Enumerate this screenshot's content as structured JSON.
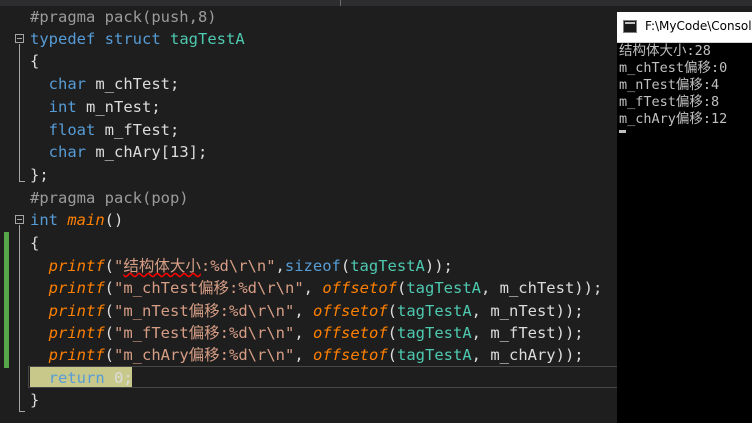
{
  "editor": {
    "lines": [
      [
        [
          "pp",
          "#pragma pack(push,8)"
        ]
      ],
      [
        [
          "kw",
          "typedef"
        ],
        [
          "id",
          " "
        ],
        [
          "kw",
          "struct"
        ],
        [
          "id",
          " "
        ],
        [
          "ty",
          "tagTestA"
        ]
      ],
      [
        [
          "id",
          "{"
        ]
      ],
      [
        [
          "id",
          "  "
        ],
        [
          "kw",
          "char"
        ],
        [
          "id",
          " m_chTest;"
        ]
      ],
      [
        [
          "id",
          "  "
        ],
        [
          "kw",
          "int"
        ],
        [
          "id",
          " m_nTest;"
        ]
      ],
      [
        [
          "id",
          "  "
        ],
        [
          "kw",
          "float"
        ],
        [
          "id",
          " m_fTest;"
        ]
      ],
      [
        [
          "id",
          "  "
        ],
        [
          "kw",
          "char"
        ],
        [
          "id",
          " m_chAry[13];"
        ]
      ],
      [
        [
          "id",
          "};"
        ]
      ],
      [
        [
          "pp",
          "#pragma pack(pop)"
        ]
      ],
      [
        [
          "kw",
          "int"
        ],
        [
          "id",
          " "
        ],
        [
          "fn",
          "main"
        ],
        [
          "id",
          "()"
        ]
      ],
      [
        [
          "id",
          "{"
        ]
      ],
      [
        [
          "id",
          "  "
        ],
        [
          "fn",
          "printf"
        ],
        [
          "id",
          "("
        ],
        [
          "st",
          "\""
        ],
        [
          "st sq",
          "结构体大小"
        ],
        [
          "st",
          ":%d\\r\\n\""
        ],
        [
          "id",
          ","
        ],
        [
          "kw",
          "sizeof"
        ],
        [
          "id",
          "("
        ],
        [
          "ty",
          "tagTestA"
        ],
        [
          "id",
          "));"
        ]
      ],
      [
        [
          "id",
          "  "
        ],
        [
          "fn",
          "printf"
        ],
        [
          "id",
          "("
        ],
        [
          "st",
          "\"m_chTest偏移:%d\\r\\n\""
        ],
        [
          "id",
          ", "
        ],
        [
          "fn",
          "offsetof"
        ],
        [
          "id",
          "("
        ],
        [
          "ty",
          "tagTestA"
        ],
        [
          "id",
          ", m_chTest));"
        ]
      ],
      [
        [
          "id",
          "  "
        ],
        [
          "fn",
          "printf"
        ],
        [
          "id",
          "("
        ],
        [
          "st",
          "\"m_nTest偏移:%d\\r\\n\""
        ],
        [
          "id",
          ", "
        ],
        [
          "fn",
          "offsetof"
        ],
        [
          "id",
          "("
        ],
        [
          "ty",
          "tagTestA"
        ],
        [
          "id",
          ", m_nTest));"
        ]
      ],
      [
        [
          "id",
          "  "
        ],
        [
          "fn",
          "printf"
        ],
        [
          "id",
          "("
        ],
        [
          "st",
          "\"m_fTest偏移:%d\\r\\n\""
        ],
        [
          "id",
          ", "
        ],
        [
          "fn",
          "offsetof"
        ],
        [
          "id",
          "("
        ],
        [
          "ty",
          "tagTestA"
        ],
        [
          "id",
          ", m_fTest));"
        ]
      ],
      [
        [
          "id",
          "  "
        ],
        [
          "fn",
          "printf"
        ],
        [
          "id",
          "("
        ],
        [
          "st",
          "\"m_chAry偏移:%d\\r\\n\""
        ],
        [
          "id",
          ", "
        ],
        [
          "fn",
          "offsetof"
        ],
        [
          "id",
          "("
        ],
        [
          "ty",
          "tagTestA"
        ],
        [
          "id",
          ", m_chAry));"
        ]
      ],
      [
        [
          "id",
          "  "
        ],
        [
          "kw",
          "return"
        ],
        [
          "id",
          " 0;"
        ]
      ],
      [
        [
          "id",
          "}"
        ]
      ]
    ]
  },
  "console": {
    "title": "F:\\MyCode\\Console",
    "output": [
      "结构体大小:28",
      "m_chTest偏移:0",
      "m_nTest偏移:4",
      "m_fTest偏移:8",
      "m_chAry偏移:12"
    ]
  },
  "colors": {
    "keyword": "#569cd6",
    "type": "#4ec9b0",
    "function": "#ff8000",
    "string": "#d69d85",
    "preprocessor": "#9b9b9b",
    "identifier": "#dcdcdc",
    "background": "#1e1e1e",
    "change_marker": "#57a64a",
    "return_highlight": "#c8c88a"
  }
}
